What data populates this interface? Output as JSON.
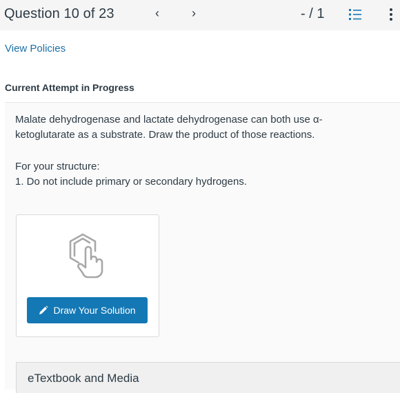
{
  "header": {
    "question_label": "Question 10 of 23",
    "prev_glyph": "‹",
    "next_glyph": "›",
    "score": "- / 1",
    "list_icon": "numbered-list-icon",
    "menu_icon": "kebab-menu-icon"
  },
  "links": {
    "view_policies": "View Policies"
  },
  "attempt": {
    "heading": "Current Attempt in Progress"
  },
  "question": {
    "line1": "Malate dehydrogenase and lactate dehydrogenase can both use α-",
    "line2": "ketoglutarate as a substrate. Draw the product of those reactions.",
    "line3": "For your structure:",
    "line4": "1. Do not include primary or secondary hydrogens."
  },
  "drawing": {
    "icon": "draw-structure-icon",
    "button_label": "Draw Your Solution",
    "button_icon": "pencil-icon",
    "button_color": "#1478b5"
  },
  "resources": {
    "label": "eTextbook and Media"
  },
  "colors": {
    "link": "#1a6fa6",
    "accent": "#1478b5",
    "text": "#2d3b45",
    "header_bg": "#f5f5f5"
  }
}
